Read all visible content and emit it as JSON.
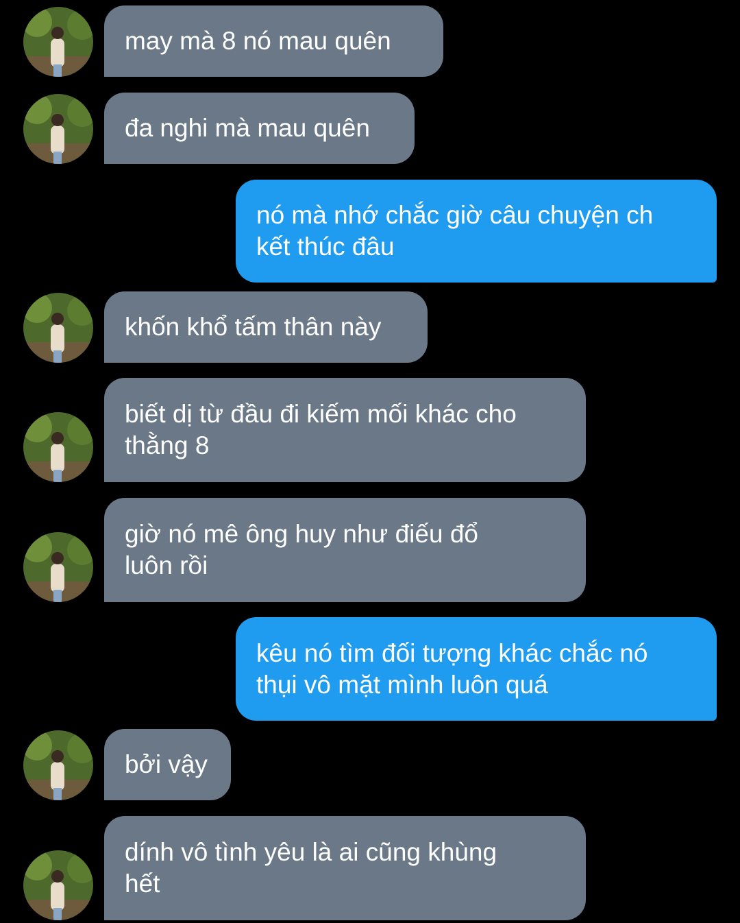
{
  "messages": [
    {
      "side": "in",
      "text": "may mà 8 nó mau quên"
    },
    {
      "side": "in",
      "text": "đa nghi mà mau quên"
    },
    {
      "side": "out",
      "text": "nó mà nhớ chắc giờ câu chuyện ch\nkết thúc đâu"
    },
    {
      "side": "in",
      "text": "khốn khổ tấm thân này"
    },
    {
      "side": "in",
      "text": "biết dị từ đầu đi kiếm mối khác cho\nthằng 8"
    },
    {
      "side": "in",
      "text": "giờ nó mê ông huy như điếu đổ\nluôn rồi"
    },
    {
      "side": "out",
      "text": "kêu nó tìm đối tượng khác chắc nó\nthụi vô mặt mình luôn quá"
    },
    {
      "side": "in",
      "text": "bởi vậy"
    },
    {
      "side": "in",
      "text": "dính vô tình yêu là ai cũng khùng\nhết"
    }
  ],
  "colors": {
    "background": "#000000",
    "incoming_bubble": "#6a7887",
    "outgoing_bubble": "#1f9bef",
    "text": "#ffffff"
  },
  "icons": {
    "avatar": "contact-avatar-photo"
  }
}
